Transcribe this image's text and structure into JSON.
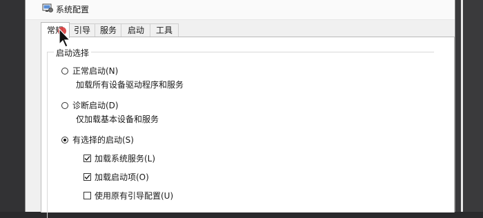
{
  "window": {
    "title": "系统配置",
    "icon": "system-config-icon"
  },
  "tabs": [
    {
      "label": "常规",
      "active": true
    },
    {
      "label": "引导",
      "active": false
    },
    {
      "label": "服务",
      "active": false
    },
    {
      "label": "启动",
      "active": false
    },
    {
      "label": "工具",
      "active": false
    }
  ],
  "startup": {
    "group_label": "启动选择",
    "options": [
      {
        "label": "正常启动(N)",
        "desc": "加载所有设备驱动程序和服务",
        "selected": false
      },
      {
        "label": "诊断启动(D)",
        "desc": "仅加载基本设备和服务",
        "selected": false
      },
      {
        "label": "有选择的启动(S)",
        "selected": true
      }
    ],
    "checks": [
      {
        "label": "加载系统服务(L)",
        "checked": true
      },
      {
        "label": "加载启动项(O)",
        "checked": true
      },
      {
        "label": "使用原有引导配置(U)",
        "checked": false
      }
    ]
  },
  "colors": {
    "window_bg": "#f0f0f0",
    "page_bg": "#ffffff",
    "cursor_dot": "#d83b3b"
  }
}
